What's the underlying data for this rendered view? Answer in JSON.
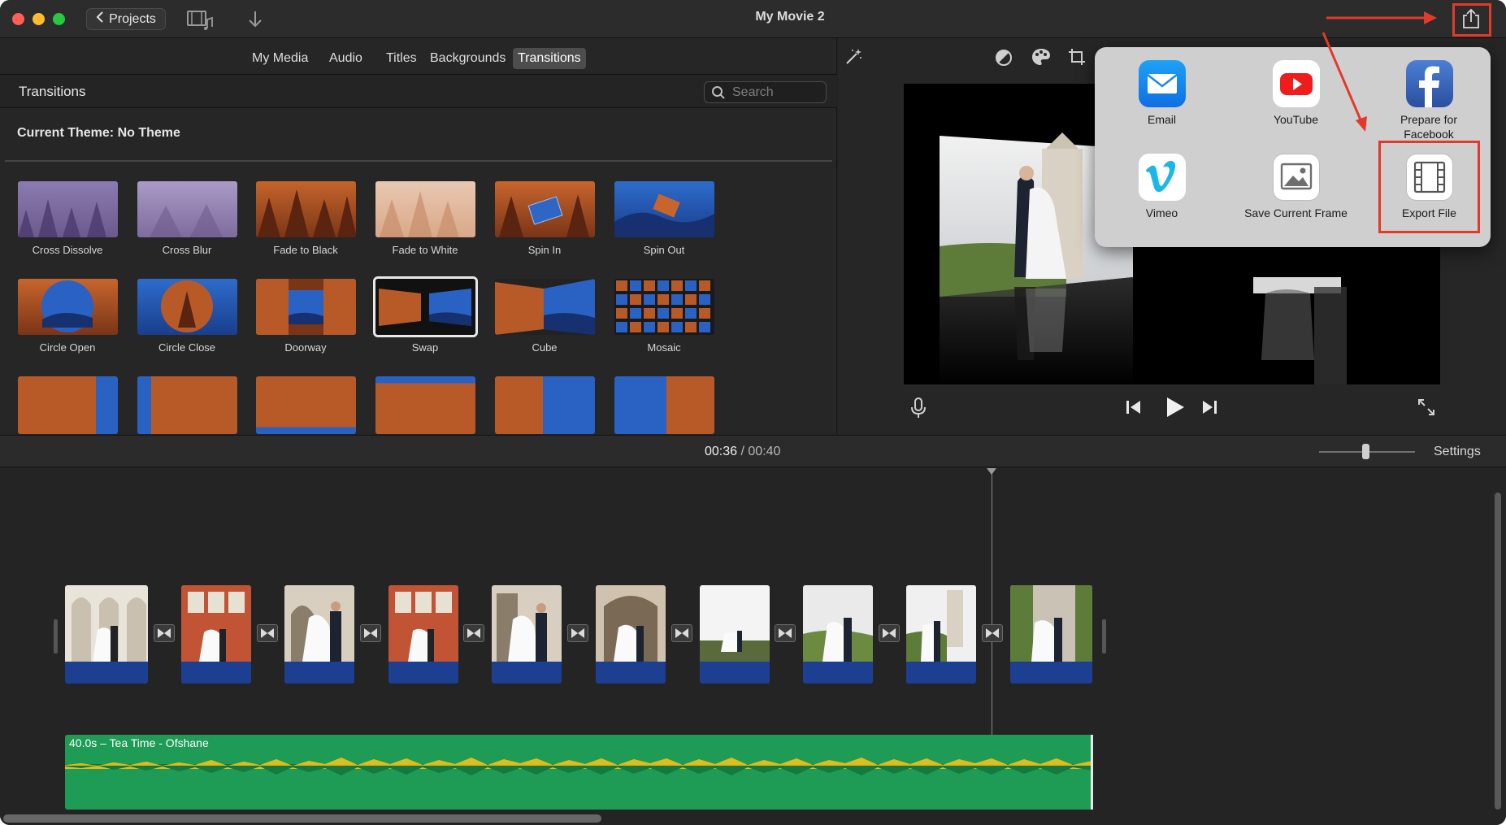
{
  "window": {
    "title": "My Movie 2"
  },
  "toolbar": {
    "projects_label": "Projects"
  },
  "media_tabs": [
    {
      "label": "My Media",
      "active": false
    },
    {
      "label": "Audio",
      "active": false
    },
    {
      "label": "Titles",
      "active": false
    },
    {
      "label": "Backgrounds",
      "active": false
    },
    {
      "label": "Transitions",
      "active": true
    }
  ],
  "library": {
    "title": "Transitions",
    "search_placeholder": "Search",
    "theme_label": "Current Theme: No Theme",
    "transitions": [
      {
        "label": "Cross Dissolve"
      },
      {
        "label": "Cross Blur"
      },
      {
        "label": "Fade to Black"
      },
      {
        "label": "Fade to White"
      },
      {
        "label": "Spin In"
      },
      {
        "label": "Spin Out"
      },
      {
        "label": "Circle Open"
      },
      {
        "label": "Circle Close"
      },
      {
        "label": "Doorway"
      },
      {
        "label": "Swap",
        "selected": true
      },
      {
        "label": "Cube"
      },
      {
        "label": "Mosaic"
      }
    ]
  },
  "share_menu": {
    "items": [
      {
        "label": "Email",
        "icon": "email-icon"
      },
      {
        "label": "YouTube",
        "icon": "youtube-icon"
      },
      {
        "label": "Prepare for Facebook",
        "icon": "facebook-icon"
      },
      {
        "label": "Vimeo",
        "icon": "vimeo-icon"
      },
      {
        "label": "Save Current Frame",
        "icon": "photo-icon"
      },
      {
        "label": "Export File",
        "icon": "film-icon",
        "highlighted": true
      }
    ]
  },
  "timeline": {
    "current_time": "00:36",
    "separator": "/",
    "total_time": "00:40",
    "settings_label": "Settings",
    "audio_clip_label": "40.0s – Tea Time - Ofshane"
  },
  "colors": {
    "accent_red": "#e23a2a",
    "clip_blue": "#1c3f91",
    "audio_green": "#1e9b54",
    "waveform_yellow": "#f3c21a"
  }
}
